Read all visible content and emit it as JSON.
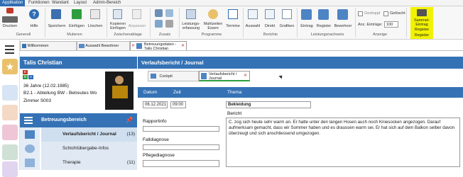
{
  "menubar": {
    "tabs": [
      "Applikation",
      "Funktionen",
      "Wandant",
      "Layout",
      "Admin-Bereich"
    ]
  },
  "ribbon": {
    "groups": {
      "generell": "Generell",
      "mutieren": "Mutieren",
      "zwischenablage": "Zwischenablage",
      "zusatz": "Zusatz",
      "programme": "Programme",
      "berichte": "Berichte",
      "leistungsnachweis": "Leistungsnachweis",
      "anzeige": "Anzeige",
      "register": "Register"
    },
    "buttons": {
      "drucken": "Drucken",
      "hilfe": "Hilfe",
      "speichern": "Speichern",
      "einfuegen": "Einfügen",
      "loeschen": "Löschen",
      "kopieren": "Kopieren",
      "einfuegen2": "Einfügen",
      "anpassen": "Anpassen",
      "leistungserfassung_1": "Leistungs-",
      "leistungserfassung_2": "erfassung",
      "mahlzeiten_1": "Mahlzeiten",
      "mahlzeiten_2": "Essen",
      "termine": "Termine",
      "auswahl": "Auswahl",
      "direkt": "Direkt",
      "grafiken": "Grafiken",
      "eintrag": "Eintrag",
      "register": "Register",
      "bewohner": "Bewohner",
      "sammel_1": "Sammel-",
      "sammel_2": "Eintrag",
      "sammel_3": "Register"
    },
    "checkboxes": {
      "gestoppt": "Gestoppt",
      "geloescht": "Gelöscht"
    },
    "anz_eintraege_label": "Anz. Einträge:",
    "anz_eintraege_value": "100"
  },
  "tabstrip": {
    "willkommen": "Willkommen",
    "auswahl_bewohner": "Auswahl Bewohner",
    "betreuungsdaten_1": "Betreuungsdaten -",
    "betreuungsdaten_2": "Talis Christian"
  },
  "patient": {
    "name": "Talis  Christian",
    "age": "36 Jahre (12.02.1985)",
    "unit": "B2.1 - Abteilung BW - Betreutes Wo",
    "room": "Zimmer S003",
    "badges": [
      "E",
      "R",
      "A"
    ]
  },
  "betreuung": {
    "title": "Betreuungsbereich",
    "items": [
      {
        "label": "Verlaufsbericht / Journal",
        "count": "(13)"
      },
      {
        "label": "Schichtübergabe-Infos",
        "count": ""
      },
      {
        "label": "Therapie",
        "count": "(11)"
      }
    ]
  },
  "main": {
    "title": "Verlaufsbericht / Journal",
    "subtabs": {
      "cockpit": "Cockpit",
      "verlauf_1": "Verlaufsbericht /",
      "verlauf_2": "Journal"
    },
    "columns": {
      "datum": "Datum",
      "zeit": "Zeit",
      "thema": "Thema"
    },
    "entry": {
      "date": "06.12.2021",
      "time": "09:00",
      "thema": "Bekleidung",
      "bericht_label": "Bericht",
      "bericht_text": "C. zog sich heute sehr warm an. Er hatte unter den langen Hosen auch noch Kniesocken angezogen. Darauf aufmerksam gemacht, dass wir Sommer haben und es draussen warm sei. Er hat sich auf dem Balkon selber davon überzeugt und sich anschliessend umgezogen."
    },
    "labels": {
      "rapportinfo": "Rapportinfo",
      "falldiagnose": "Falldiagnose",
      "pflegediagnose": "Pflegediagnose"
    }
  },
  "colors": {
    "primary_blue": "#3572b5",
    "menu_active": "#2f6db3",
    "register_highlight": "#f2f200"
  }
}
